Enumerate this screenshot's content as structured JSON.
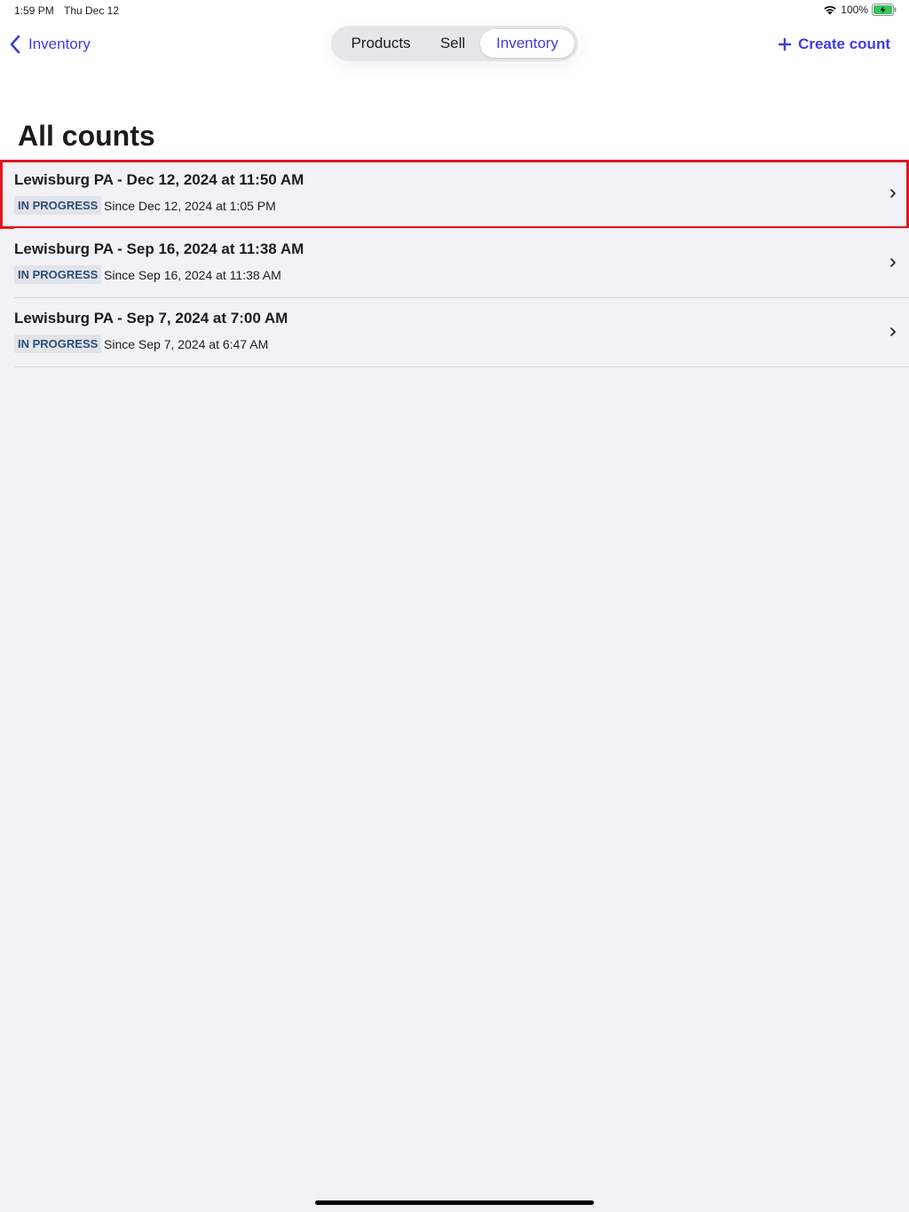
{
  "status_bar": {
    "time": "1:59 PM",
    "date": "Thu Dec 12",
    "battery": "100%"
  },
  "nav": {
    "back_label": "Inventory",
    "segments": [
      "Products",
      "Sell",
      "Inventory"
    ],
    "selected_segment": "Inventory",
    "create_label": "Create count"
  },
  "page": {
    "title": "All counts"
  },
  "counts": [
    {
      "title": "Lewisburg PA - Dec 12, 2024 at 11:50 AM",
      "status": "IN PROGRESS",
      "since": "Since Dec 12, 2024 at 1:05 PM"
    },
    {
      "title": "Lewisburg PA - Sep 16, 2024 at 11:38 AM",
      "status": "IN PROGRESS",
      "since": "Since Sep 16, 2024 at 11:38 AM"
    },
    {
      "title": "Lewisburg PA - Sep 7, 2024 at 7:00 AM",
      "status": "IN PROGRESS",
      "since": "Since Sep 7, 2024 at 6:47 AM"
    }
  ],
  "colors": {
    "accent": "#3d3ce0",
    "badge_text": "#2d4d7a",
    "badge_bg": "#e2e3e8",
    "highlight": "#e0161f",
    "battery_green": "#34c759"
  },
  "icons": {
    "wifi": "wifi-icon",
    "battery": "battery-charging-icon",
    "back": "chevron-left-icon",
    "create": "plus-icon",
    "row": "chevron-right-icon"
  }
}
